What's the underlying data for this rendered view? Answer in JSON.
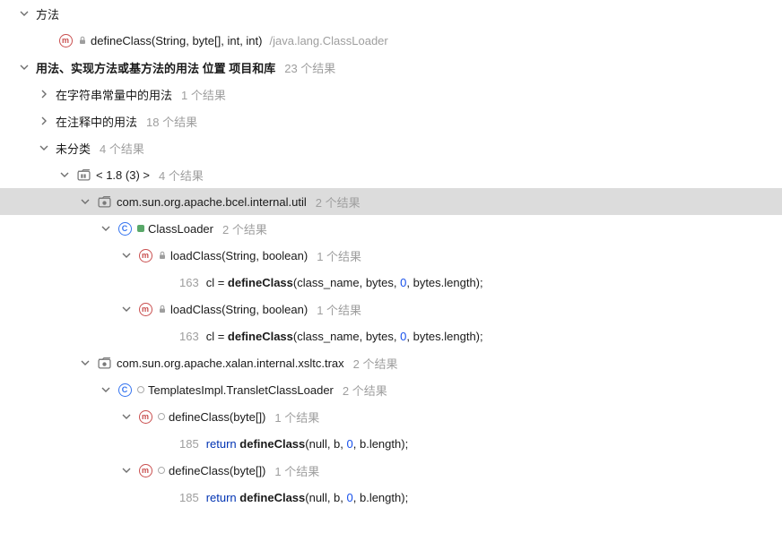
{
  "root": {
    "methods_label": "方法",
    "method": {
      "signature": "defineClass(String, byte[], int, int)",
      "location": "/java.lang.ClassLoader"
    },
    "usages_label": "用法、实现方法或基方法的用法 位置 项目和库",
    "usages_count": "23 个结果",
    "groups": {
      "string_const": {
        "label": "在字符串常量中的用法",
        "count": "1 个结果"
      },
      "comments": {
        "label": "在注释中的用法",
        "count": "18 个结果"
      },
      "unclassified": {
        "label": "未分类",
        "count": "4 个结果",
        "lib": {
          "label": "< 1.8 (3) >",
          "count": "4 个结果"
        },
        "packages": [
          {
            "name": "com.sun.org.apache.bcel.internal.util",
            "count": "2 个结果",
            "class": {
              "name": "ClassLoader",
              "count": "2 个结果",
              "badge": "green"
            },
            "methods": [
              {
                "signature": "loadClass(String, boolean)",
                "count": "1 个结果",
                "line": "163",
                "code": {
                  "lhs": "cl = ",
                  "call": "defineClass",
                  "args_pre": "(class_name, bytes, ",
                  "num": "0",
                  "args_post": ", bytes.length);"
                }
              },
              {
                "signature": "loadClass(String, boolean)",
                "count": "1 个结果",
                "line": "163",
                "code": {
                  "lhs": "cl = ",
                  "call": "defineClass",
                  "args_pre": "(class_name, bytes, ",
                  "num": "0",
                  "args_post": ", bytes.length);"
                }
              }
            ]
          },
          {
            "name": "com.sun.org.apache.xalan.internal.xsltc.trax",
            "count": "2 个结果",
            "class": {
              "name": "TemplatesImpl.TransletClassLoader",
              "count": "2 个结果",
              "badge": "white"
            },
            "methods": [
              {
                "signature": "defineClass(byte[])",
                "count": "1 个结果",
                "line": "185",
                "code": {
                  "kw": "return ",
                  "call": "defineClass",
                  "args_pre": "(null, b, ",
                  "num": "0",
                  "args_post": ", b.length);"
                }
              },
              {
                "signature": "defineClass(byte[])",
                "count": "1 个结果",
                "line": "185",
                "code": {
                  "kw": "return ",
                  "call": "defineClass",
                  "args_pre": "(null, b, ",
                  "num": "0",
                  "args_post": ", b.length);"
                }
              }
            ]
          }
        ]
      }
    }
  }
}
